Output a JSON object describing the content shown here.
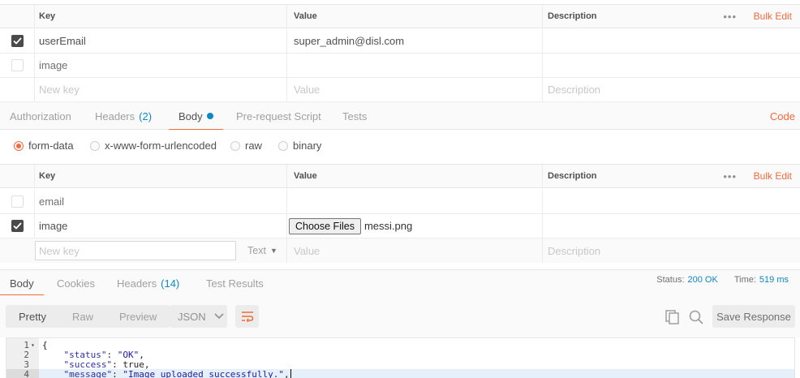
{
  "params_table": {
    "header": {
      "key": "Key",
      "value": "Value",
      "description": "Description",
      "more": "•••",
      "bulk_edit": "Bulk Edit"
    },
    "rows": [
      {
        "key": "userEmail",
        "value": "super_admin@disl.com",
        "checked": true
      },
      {
        "key": "image",
        "value": "",
        "checked": false
      }
    ],
    "new_row": {
      "key_placeholder": "New key",
      "value_placeholder": "Value",
      "description_placeholder": "Description"
    }
  },
  "request_tabs": {
    "items": [
      {
        "label": "Authorization"
      },
      {
        "label": "Headers",
        "count": "(2)"
      },
      {
        "label": "Body"
      },
      {
        "label": "Pre-request Script"
      },
      {
        "label": "Tests"
      }
    ],
    "active": "Body",
    "code_link": "Code"
  },
  "body_modes": {
    "options": [
      "form-data",
      "x-www-form-urlencoded",
      "raw",
      "binary"
    ],
    "selected": "form-data"
  },
  "form_table": {
    "header": {
      "key": "Key",
      "value": "Value",
      "description": "Description",
      "more": "•••",
      "bulk_edit": "Bulk Edit"
    },
    "rows": [
      {
        "key": "email",
        "value": "",
        "checked": false
      },
      {
        "key": "image",
        "file_button": "Choose Files",
        "file_name": "messi.png",
        "checked": true
      }
    ],
    "new_row": {
      "key_placeholder": "New key",
      "type": "Text",
      "value_placeholder": "Value",
      "description_placeholder": "Description"
    }
  },
  "response": {
    "tabs": [
      {
        "label": "Body"
      },
      {
        "label": "Cookies"
      },
      {
        "label": "Headers",
        "count": "(14)"
      },
      {
        "label": "Test Results"
      }
    ],
    "active": "Body",
    "status_label": "Status:",
    "status_value": "200 OK",
    "time_label": "Time:",
    "time_value": "519 ms",
    "view_modes": [
      "Pretty",
      "Raw",
      "Preview"
    ],
    "active_view": "Pretty",
    "format": "JSON",
    "save_label": "Save Response",
    "icons": {
      "wrap": "wrap-lines-icon",
      "copy": "copy-icon",
      "search": "search-icon"
    }
  },
  "code": {
    "lines": [
      {
        "n": "1",
        "fold": "▾",
        "text": "{"
      },
      {
        "n": "2",
        "key": "\"status\"",
        "val": "\"OK\"",
        "tail": ","
      },
      {
        "n": "3",
        "key": "\"success\"",
        "val": "true",
        "tail": ","
      },
      {
        "n": "4",
        "key": "\"message\"",
        "val": "\"Image uploaded successfully.\"",
        "tail": ","
      }
    ]
  },
  "colors": {
    "accent": "#f26b3a",
    "link": "#0d87c5"
  }
}
